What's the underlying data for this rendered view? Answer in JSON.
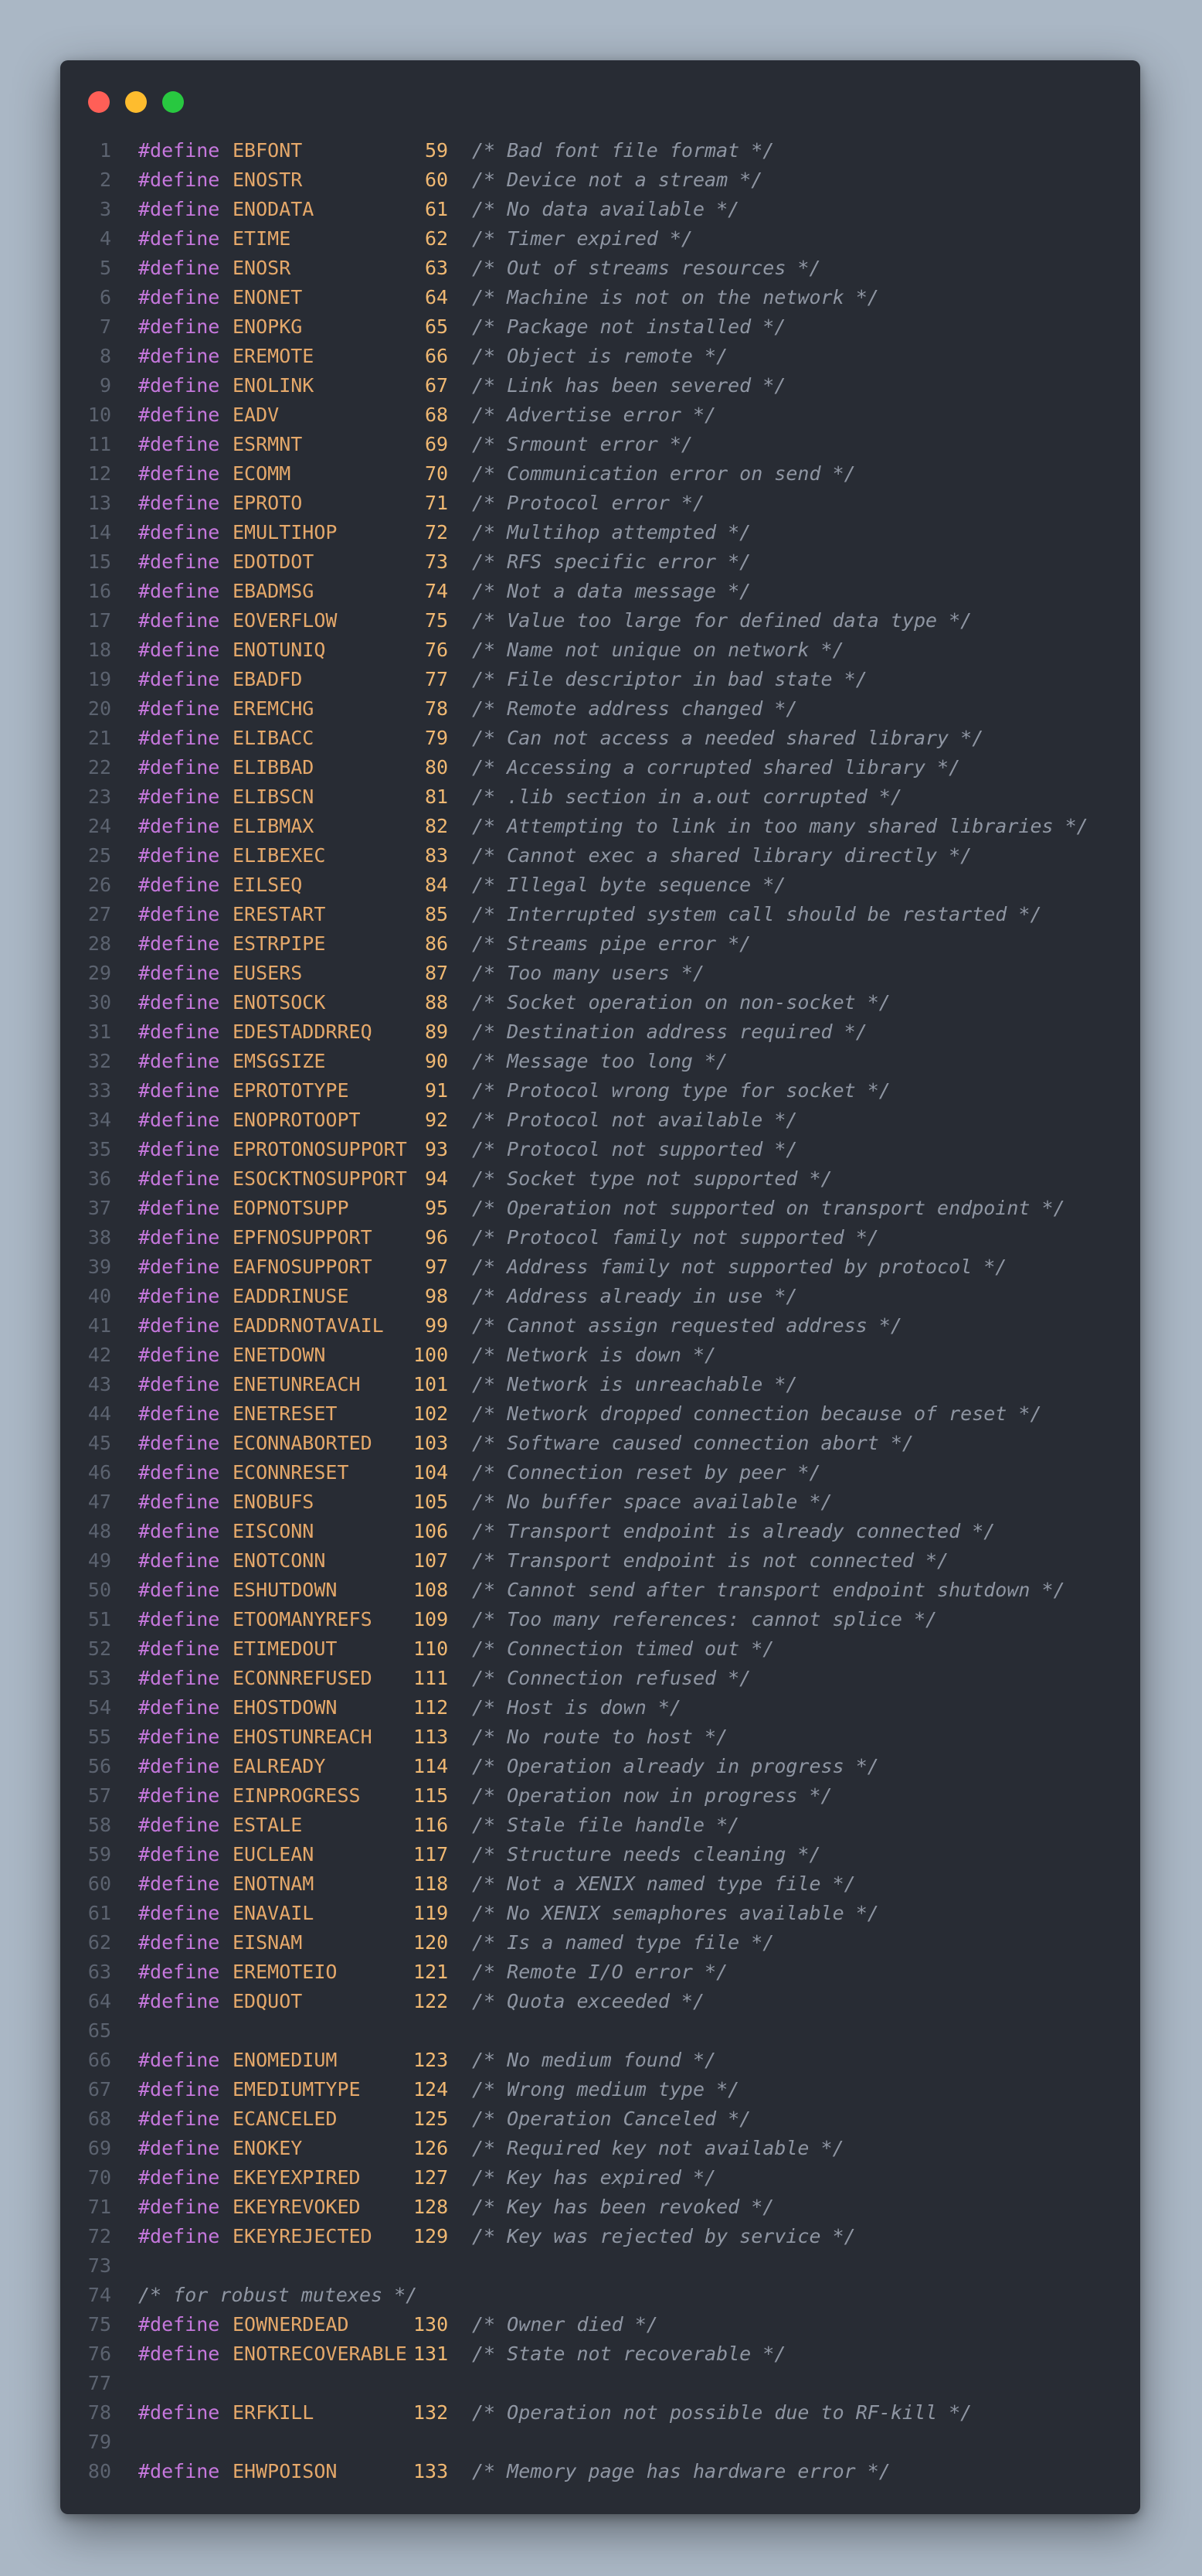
{
  "window": {
    "traffic_lights": {
      "red": "#ff5f57",
      "yellow": "#febc2e",
      "green": "#28c840"
    }
  },
  "lines": [
    {
      "n": "1",
      "kw": "#define",
      "name": "EBFONT",
      "val": "59",
      "comment": "/* Bad font file format */"
    },
    {
      "n": "2",
      "kw": "#define",
      "name": "ENOSTR",
      "val": "60",
      "comment": "/* Device not a stream */"
    },
    {
      "n": "3",
      "kw": "#define",
      "name": "ENODATA",
      "val": "61",
      "comment": "/* No data available */"
    },
    {
      "n": "4",
      "kw": "#define",
      "name": "ETIME",
      "val": "62",
      "comment": "/* Timer expired */"
    },
    {
      "n": "5",
      "kw": "#define",
      "name": "ENOSR",
      "val": "63",
      "comment": "/* Out of streams resources */"
    },
    {
      "n": "6",
      "kw": "#define",
      "name": "ENONET",
      "val": "64",
      "comment": "/* Machine is not on the network */"
    },
    {
      "n": "7",
      "kw": "#define",
      "name": "ENOPKG",
      "val": "65",
      "comment": "/* Package not installed */"
    },
    {
      "n": "8",
      "kw": "#define",
      "name": "EREMOTE",
      "val": "66",
      "comment": "/* Object is remote */"
    },
    {
      "n": "9",
      "kw": "#define",
      "name": "ENOLINK",
      "val": "67",
      "comment": "/* Link has been severed */"
    },
    {
      "n": "10",
      "kw": "#define",
      "name": "EADV",
      "val": "68",
      "comment": "/* Advertise error */"
    },
    {
      "n": "11",
      "kw": "#define",
      "name": "ESRMNT",
      "val": "69",
      "comment": "/* Srmount error */"
    },
    {
      "n": "12",
      "kw": "#define",
      "name": "ECOMM",
      "val": "70",
      "comment": "/* Communication error on send */"
    },
    {
      "n": "13",
      "kw": "#define",
      "name": "EPROTO",
      "val": "71",
      "comment": "/* Protocol error */"
    },
    {
      "n": "14",
      "kw": "#define",
      "name": "EMULTIHOP",
      "val": "72",
      "comment": "/* Multihop attempted */"
    },
    {
      "n": "15",
      "kw": "#define",
      "name": "EDOTDOT",
      "val": "73",
      "comment": "/* RFS specific error */"
    },
    {
      "n": "16",
      "kw": "#define",
      "name": "EBADMSG",
      "val": "74",
      "comment": "/* Not a data message */"
    },
    {
      "n": "17",
      "kw": "#define",
      "name": "EOVERFLOW",
      "val": "75",
      "comment": "/* Value too large for defined data type */"
    },
    {
      "n": "18",
      "kw": "#define",
      "name": "ENOTUNIQ",
      "val": "76",
      "comment": "/* Name not unique on network */"
    },
    {
      "n": "19",
      "kw": "#define",
      "name": "EBADFD",
      "val": "77",
      "comment": "/* File descriptor in bad state */"
    },
    {
      "n": "20",
      "kw": "#define",
      "name": "EREMCHG",
      "val": "78",
      "comment": "/* Remote address changed */"
    },
    {
      "n": "21",
      "kw": "#define",
      "name": "ELIBACC",
      "val": "79",
      "comment": "/* Can not access a needed shared library */"
    },
    {
      "n": "22",
      "kw": "#define",
      "name": "ELIBBAD",
      "val": "80",
      "comment": "/* Accessing a corrupted shared library */"
    },
    {
      "n": "23",
      "kw": "#define",
      "name": "ELIBSCN",
      "val": "81",
      "comment": "/* .lib section in a.out corrupted */"
    },
    {
      "n": "24",
      "kw": "#define",
      "name": "ELIBMAX",
      "val": "82",
      "comment": "/* Attempting to link in too many shared libraries */"
    },
    {
      "n": "25",
      "kw": "#define",
      "name": "ELIBEXEC",
      "val": "83",
      "comment": "/* Cannot exec a shared library directly */"
    },
    {
      "n": "26",
      "kw": "#define",
      "name": "EILSEQ",
      "val": "84",
      "comment": "/* Illegal byte sequence */"
    },
    {
      "n": "27",
      "kw": "#define",
      "name": "ERESTART",
      "val": "85",
      "comment": "/* Interrupted system call should be restarted */"
    },
    {
      "n": "28",
      "kw": "#define",
      "name": "ESTRPIPE",
      "val": "86",
      "comment": "/* Streams pipe error */"
    },
    {
      "n": "29",
      "kw": "#define",
      "name": "EUSERS",
      "val": "87",
      "comment": "/* Too many users */"
    },
    {
      "n": "30",
      "kw": "#define",
      "name": "ENOTSOCK",
      "val": "88",
      "comment": "/* Socket operation on non-socket */"
    },
    {
      "n": "31",
      "kw": "#define",
      "name": "EDESTADDRREQ",
      "val": "89",
      "comment": "/* Destination address required */"
    },
    {
      "n": "32",
      "kw": "#define",
      "name": "EMSGSIZE",
      "val": "90",
      "comment": "/* Message too long */"
    },
    {
      "n": "33",
      "kw": "#define",
      "name": "EPROTOTYPE",
      "val": "91",
      "comment": "/* Protocol wrong type for socket */"
    },
    {
      "n": "34",
      "kw": "#define",
      "name": "ENOPROTOOPT",
      "val": "92",
      "comment": "/* Protocol not available */"
    },
    {
      "n": "35",
      "kw": "#define",
      "name": "EPROTONOSUPPORT",
      "val": "93",
      "comment": "/* Protocol not supported */"
    },
    {
      "n": "36",
      "kw": "#define",
      "name": "ESOCKTNOSUPPORT",
      "val": "94",
      "comment": "/* Socket type not supported */"
    },
    {
      "n": "37",
      "kw": "#define",
      "name": "EOPNOTSUPP",
      "val": "95",
      "comment": "/* Operation not supported on transport endpoint */"
    },
    {
      "n": "38",
      "kw": "#define",
      "name": "EPFNOSUPPORT",
      "val": "96",
      "comment": "/* Protocol family not supported */"
    },
    {
      "n": "39",
      "kw": "#define",
      "name": "EAFNOSUPPORT",
      "val": "97",
      "comment": "/* Address family not supported by protocol */"
    },
    {
      "n": "40",
      "kw": "#define",
      "name": "EADDRINUSE",
      "val": "98",
      "comment": "/* Address already in use */"
    },
    {
      "n": "41",
      "kw": "#define",
      "name": "EADDRNOTAVAIL",
      "val": "99",
      "comment": "/* Cannot assign requested address */"
    },
    {
      "n": "42",
      "kw": "#define",
      "name": "ENETDOWN",
      "val": "100",
      "comment": "/* Network is down */"
    },
    {
      "n": "43",
      "kw": "#define",
      "name": "ENETUNREACH",
      "val": "101",
      "comment": "/* Network is unreachable */"
    },
    {
      "n": "44",
      "kw": "#define",
      "name": "ENETRESET",
      "val": "102",
      "comment": "/* Network dropped connection because of reset */"
    },
    {
      "n": "45",
      "kw": "#define",
      "name": "ECONNABORTED",
      "val": "103",
      "comment": "/* Software caused connection abort */"
    },
    {
      "n": "46",
      "kw": "#define",
      "name": "ECONNRESET",
      "val": "104",
      "comment": "/* Connection reset by peer */"
    },
    {
      "n": "47",
      "kw": "#define",
      "name": "ENOBUFS",
      "val": "105",
      "comment": "/* No buffer space available */"
    },
    {
      "n": "48",
      "kw": "#define",
      "name": "EISCONN",
      "val": "106",
      "comment": "/* Transport endpoint is already connected */"
    },
    {
      "n": "49",
      "kw": "#define",
      "name": "ENOTCONN",
      "val": "107",
      "comment": "/* Transport endpoint is not connected */"
    },
    {
      "n": "50",
      "kw": "#define",
      "name": "ESHUTDOWN",
      "val": "108",
      "comment": "/* Cannot send after transport endpoint shutdown */"
    },
    {
      "n": "51",
      "kw": "#define",
      "name": "ETOOMANYREFS",
      "val": "109",
      "comment": "/* Too many references: cannot splice */"
    },
    {
      "n": "52",
      "kw": "#define",
      "name": "ETIMEDOUT",
      "val": "110",
      "comment": "/* Connection timed out */"
    },
    {
      "n": "53",
      "kw": "#define",
      "name": "ECONNREFUSED",
      "val": "111",
      "comment": "/* Connection refused */"
    },
    {
      "n": "54",
      "kw": "#define",
      "name": "EHOSTDOWN",
      "val": "112",
      "comment": "/* Host is down */"
    },
    {
      "n": "55",
      "kw": "#define",
      "name": "EHOSTUNREACH",
      "val": "113",
      "comment": "/* No route to host */"
    },
    {
      "n": "56",
      "kw": "#define",
      "name": "EALREADY",
      "val": "114",
      "comment": "/* Operation already in progress */"
    },
    {
      "n": "57",
      "kw": "#define",
      "name": "EINPROGRESS",
      "val": "115",
      "comment": "/* Operation now in progress */"
    },
    {
      "n": "58",
      "kw": "#define",
      "name": "ESTALE",
      "val": "116",
      "comment": "/* Stale file handle */"
    },
    {
      "n": "59",
      "kw": "#define",
      "name": "EUCLEAN",
      "val": "117",
      "comment": "/* Structure needs cleaning */"
    },
    {
      "n": "60",
      "kw": "#define",
      "name": "ENOTNAM",
      "val": "118",
      "comment": "/* Not a XENIX named type file */"
    },
    {
      "n": "61",
      "kw": "#define",
      "name": "ENAVAIL",
      "val": "119",
      "comment": "/* No XENIX semaphores available */"
    },
    {
      "n": "62",
      "kw": "#define",
      "name": "EISNAM",
      "val": "120",
      "comment": "/* Is a named type file */"
    },
    {
      "n": "63",
      "kw": "#define",
      "name": "EREMOTEIO",
      "val": "121",
      "comment": "/* Remote I/O error */"
    },
    {
      "n": "64",
      "kw": "#define",
      "name": "EDQUOT",
      "val": "122",
      "comment": "/* Quota exceeded */"
    },
    {
      "n": "65",
      "kw": "",
      "name": "",
      "val": "",
      "comment": ""
    },
    {
      "n": "66",
      "kw": "#define",
      "name": "ENOMEDIUM",
      "val": "123",
      "comment": "/* No medium found */"
    },
    {
      "n": "67",
      "kw": "#define",
      "name": "EMEDIUMTYPE",
      "val": "124",
      "comment": "/* Wrong medium type */"
    },
    {
      "n": "68",
      "kw": "#define",
      "name": "ECANCELED",
      "val": "125",
      "comment": "/* Operation Canceled */"
    },
    {
      "n": "69",
      "kw": "#define",
      "name": "ENOKEY",
      "val": "126",
      "comment": "/* Required key not available */"
    },
    {
      "n": "70",
      "kw": "#define",
      "name": "EKEYEXPIRED",
      "val": "127",
      "comment": "/* Key has expired */"
    },
    {
      "n": "71",
      "kw": "#define",
      "name": "EKEYREVOKED",
      "val": "128",
      "comment": "/* Key has been revoked */"
    },
    {
      "n": "72",
      "kw": "#define",
      "name": "EKEYREJECTED",
      "val": "129",
      "comment": "/* Key was rejected by service */"
    },
    {
      "n": "73",
      "kw": "",
      "name": "",
      "val": "",
      "comment": ""
    },
    {
      "n": "74",
      "kw": "",
      "name": "",
      "val": "",
      "comment": "/* for robust mutexes */"
    },
    {
      "n": "75",
      "kw": "#define",
      "name": "EOWNERDEAD",
      "val": "130",
      "comment": "/* Owner died */"
    },
    {
      "n": "76",
      "kw": "#define",
      "name": "ENOTRECOVERABLE",
      "val": "131",
      "comment": "/* State not recoverable */"
    },
    {
      "n": "77",
      "kw": "",
      "name": "",
      "val": "",
      "comment": ""
    },
    {
      "n": "78",
      "kw": "#define",
      "name": "ERFKILL",
      "val": "132",
      "comment": "/* Operation not possible due to RF-kill */"
    },
    {
      "n": "79",
      "kw": "",
      "name": "",
      "val": "",
      "comment": ""
    },
    {
      "n": "80",
      "kw": "#define",
      "name": "EHWPOISON",
      "val": "133",
      "comment": "/* Memory page has hardware error */"
    }
  ]
}
